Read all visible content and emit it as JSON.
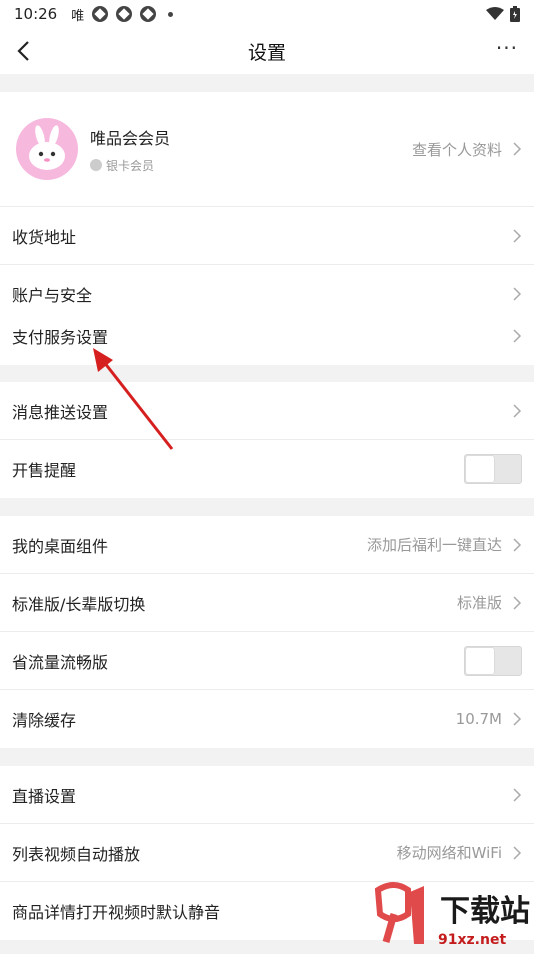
{
  "status_bar": {
    "time": "10:26",
    "carrier": "唯"
  },
  "header": {
    "title": "设置",
    "more": "···"
  },
  "profile": {
    "name": "唯品会会员",
    "badge": "银卡会员",
    "link": "查看个人资料"
  },
  "groups": {
    "g1": [
      {
        "label": "收货地址"
      },
      {
        "label": "账户与安全"
      }
    ],
    "g2": [
      {
        "label": "支付服务设置"
      }
    ],
    "g3": [
      {
        "label": "消息推送设置"
      },
      {
        "label": "开售提醒",
        "toggle": false
      }
    ],
    "g4": [
      {
        "label": "我的桌面组件",
        "value": "添加后福利一键直达"
      },
      {
        "label": "标准版/长辈版切换",
        "value": "标准版"
      },
      {
        "label": "省流量流畅版",
        "toggle": false
      },
      {
        "label": "清除缓存",
        "value": "10.7M"
      }
    ],
    "g5": [
      {
        "label": "直播设置"
      },
      {
        "label": "列表视频自动播放",
        "value": "移动网络和WiFi"
      },
      {
        "label": "商品详情打开视频时默认静音"
      }
    ]
  },
  "watermark": {
    "text": "91xz.net",
    "title": "下载站"
  },
  "colors": {
    "arrow": "#d62020",
    "avatar_bg": "#f7b8de",
    "toggle_off": "#e6e6e6"
  }
}
